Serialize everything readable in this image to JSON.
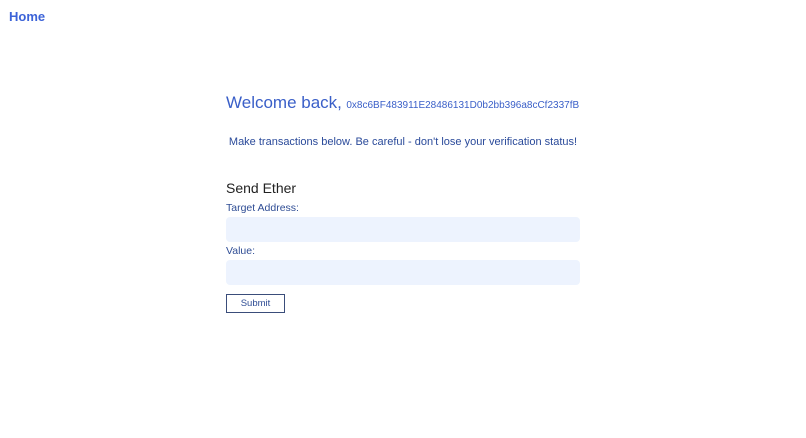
{
  "nav": {
    "home_label": "Home"
  },
  "welcome": {
    "greeting": "Welcome back,",
    "address": "0x8c6BF483911E28486131D0b2bb396a8cCf2337fB"
  },
  "notice": "Make transactions below. Be careful - don't lose your verification status!",
  "send_form": {
    "title": "Send Ether",
    "target_label": "Target Address:",
    "target_value": "",
    "value_label": "Value:",
    "value_value": "",
    "submit_label": "Submit"
  },
  "colors": {
    "accent": "#3c63d8",
    "input_bg": "#edf3fe",
    "text_blue": "#2f4d95"
  }
}
